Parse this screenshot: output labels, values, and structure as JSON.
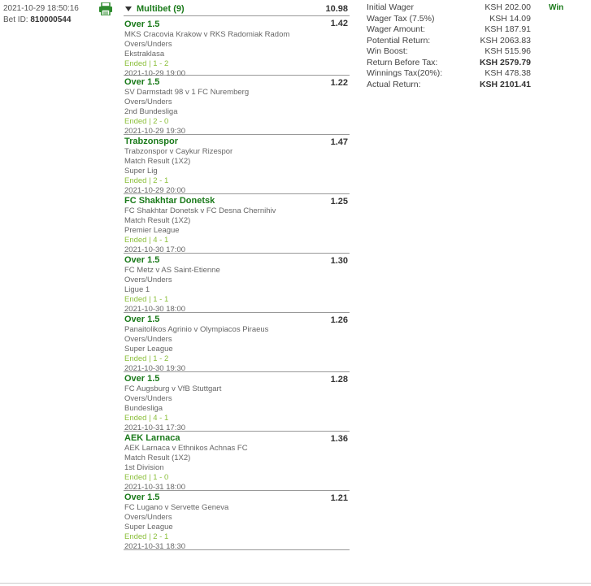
{
  "bet": {
    "datetime": "2021-10-29 18:50:16",
    "bet_id_label": "Bet ID:",
    "bet_id": "810000544",
    "print_icon": "printer-icon",
    "result": "Win"
  },
  "multibet": {
    "title": "Multibet (9)",
    "total_odds": "10.98",
    "selections": [
      {
        "name": "Over 1.5",
        "odds": "1.42",
        "match": "MKS Cracovia Krakow v RKS Radomiak Radom",
        "market": "Overs/Unders",
        "league": "Ekstraklasa",
        "status": "Ended | 1 - 2",
        "date": "2021-10-29 19:00"
      },
      {
        "name": "Over 1.5",
        "odds": "1.22",
        "match": "SV Darmstadt 98 v 1 FC Nuremberg",
        "market": "Overs/Unders",
        "league": "2nd Bundesliga",
        "status": "Ended | 2 - 0",
        "date": "2021-10-29 19:30"
      },
      {
        "name": "Trabzonspor",
        "odds": "1.47",
        "match": "Trabzonspor v Caykur Rizespor",
        "market": "Match Result (1X2)",
        "league": "Super Lig",
        "status": "Ended | 2 - 1",
        "date": "2021-10-29 20:00"
      },
      {
        "name": "FC Shakhtar Donetsk",
        "odds": "1.25",
        "match": "FC Shakhtar Donetsk v FC Desna Chernihiv",
        "market": "Match Result (1X2)",
        "league": "Premier League",
        "status": "Ended | 4 - 1",
        "date": "2021-10-30 17:00"
      },
      {
        "name": "Over 1.5",
        "odds": "1.30",
        "match": "FC Metz v AS Saint-Etienne",
        "market": "Overs/Unders",
        "league": "Ligue 1",
        "status": "Ended | 1 - 1",
        "date": "2021-10-30 18:00"
      },
      {
        "name": "Over 1.5",
        "odds": "1.26",
        "match": "Panaitolikos Agrinio v Olympiacos Piraeus",
        "market": "Overs/Unders",
        "league": "Super League",
        "status": "Ended | 1 - 2",
        "date": "2021-10-30 19:30"
      },
      {
        "name": "Over 1.5",
        "odds": "1.28",
        "match": "FC Augsburg v VfB Stuttgart",
        "market": "Overs/Unders",
        "league": "Bundesliga",
        "status": "Ended | 4 - 1",
        "date": "2021-10-31 17:30"
      },
      {
        "name": "AEK Larnaca",
        "odds": "1.36",
        "match": "AEK Larnaca v Ethnikos Achnas FC",
        "market": "Match Result (1X2)",
        "league": "1st Division",
        "status": "Ended | 1 - 0",
        "date": "2021-10-31 18:00"
      },
      {
        "name": "Over 1.5",
        "odds": "1.21",
        "match": "FC Lugano v Servette Geneva",
        "market": "Overs/Unders",
        "league": "Super League",
        "status": "Ended | 2 - 1",
        "date": "2021-10-31 18:30"
      }
    ]
  },
  "summary": [
    {
      "label": "Initial Wager",
      "value": "KSH 202.00",
      "bold": false
    },
    {
      "label": "Wager Tax (7.5%)",
      "value": "KSH 14.09",
      "bold": false
    },
    {
      "label": "Wager Amount:",
      "value": "KSH 187.91",
      "bold": false
    },
    {
      "label": "Potential Return:",
      "value": "KSH 2063.83",
      "bold": false
    },
    {
      "label": "Win Boost:",
      "value": "KSH 515.96",
      "bold": false
    },
    {
      "label": "Return Before Tax:",
      "value": "KSH 2579.79",
      "bold": true
    },
    {
      "label": "Winnings Tax(20%):",
      "value": "KSH 478.38",
      "bold": false
    },
    {
      "label": "Actual Return:",
      "value": "KSH 2101.41",
      "bold": true
    }
  ],
  "colors": {
    "accent_green": "#1a7a1a",
    "status_green": "#8bbf3a"
  }
}
